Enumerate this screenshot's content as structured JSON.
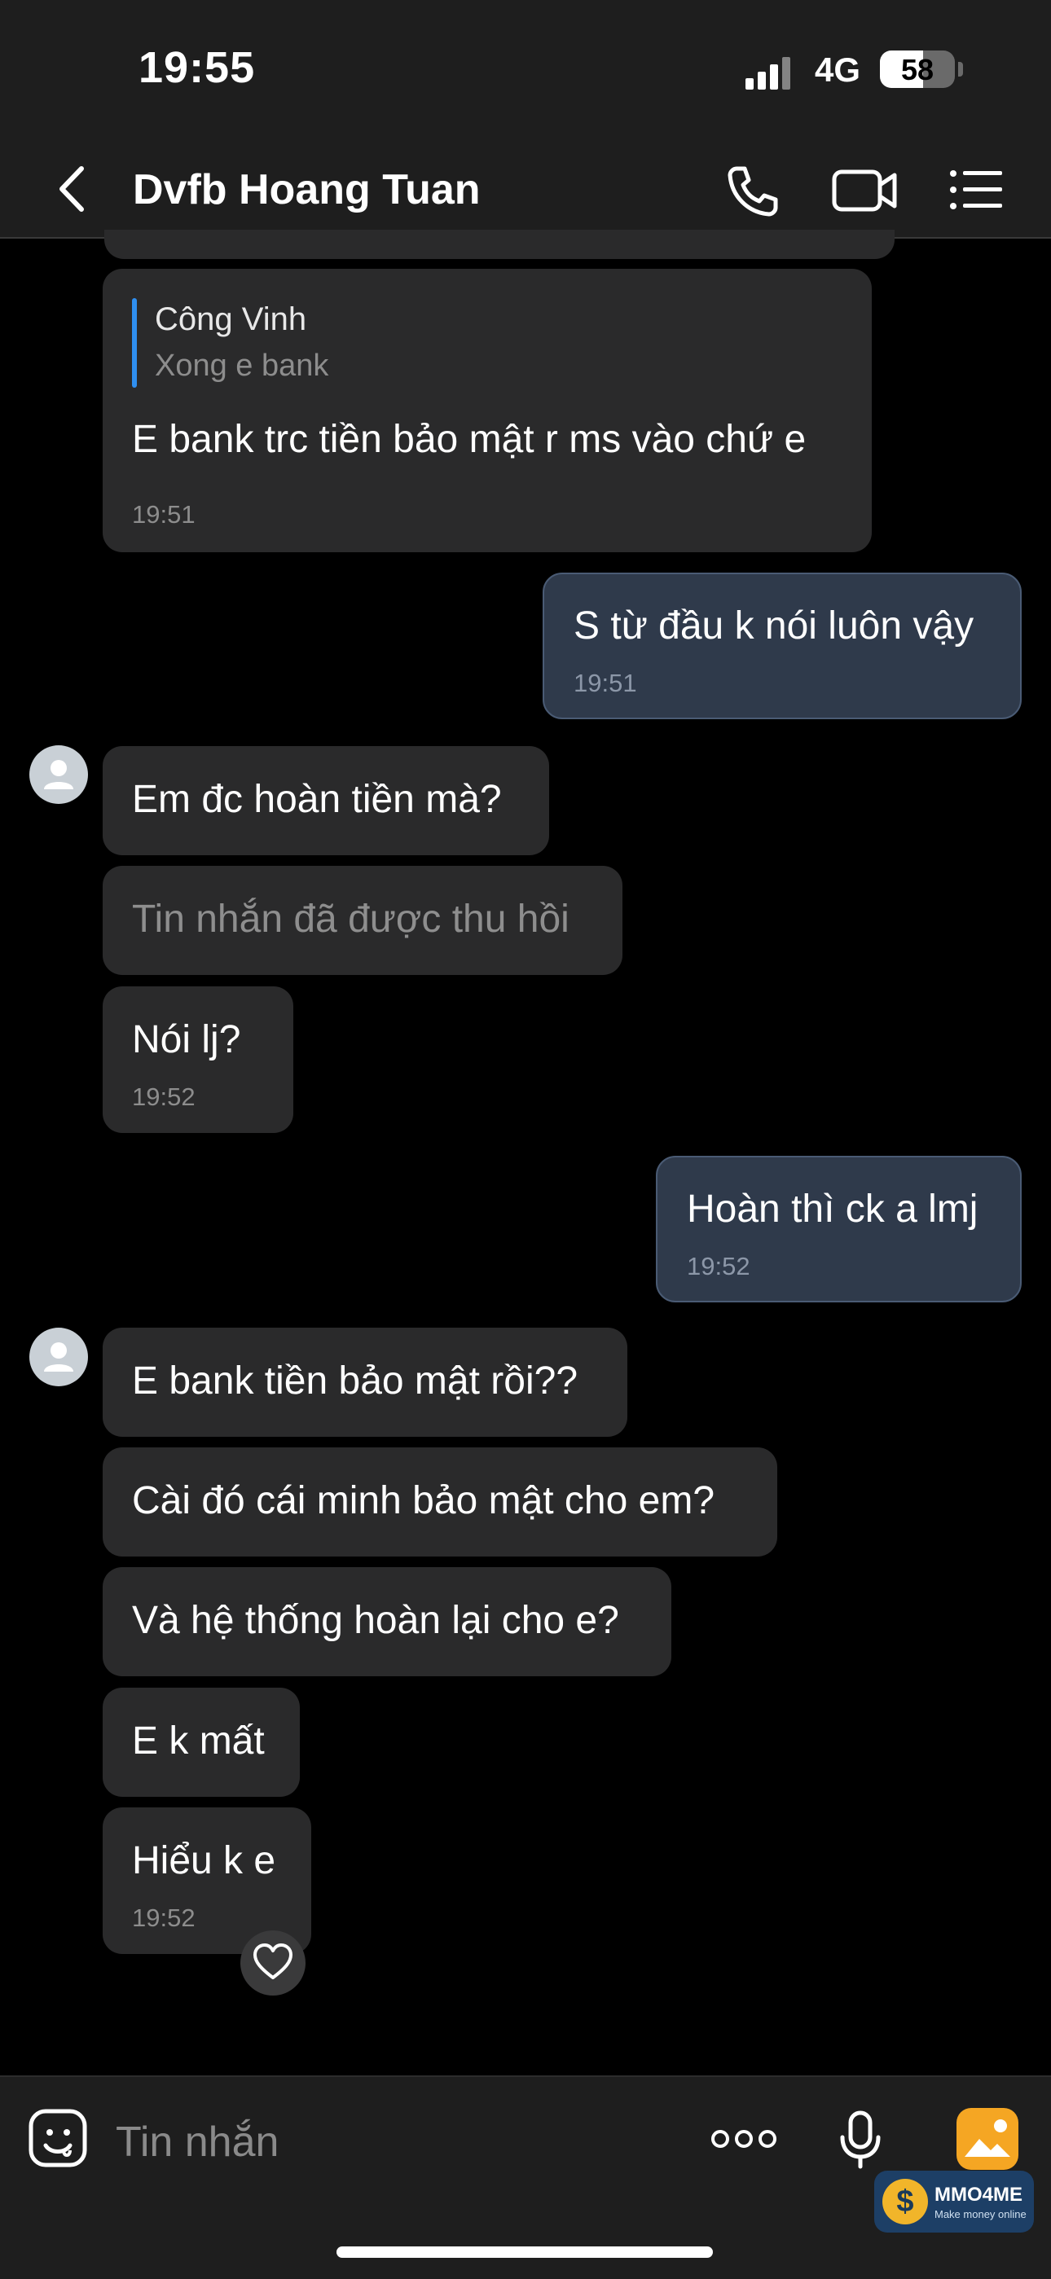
{
  "status_bar": {
    "time": "19:55",
    "network": "4G",
    "battery": "58",
    "battery_level": 0.58
  },
  "header": {
    "title": "Dvfb Hoang Tuan",
    "icons": [
      "back-icon",
      "phone-icon",
      "video-call-icon",
      "menu-list-icon"
    ]
  },
  "messages": [
    {
      "side": "in",
      "quote_name": "Công Vinh",
      "quote_text": "Xong e bank",
      "text": "E bank trc tiền bảo mật r ms vào chứ e",
      "time": "19:51"
    },
    {
      "side": "out",
      "text": "S từ đầu k nói luôn vậy",
      "time": "19:51"
    },
    {
      "side": "in",
      "text": "Em đc hoàn tiền mà?"
    },
    {
      "side": "in",
      "text": "Tin nhắn đã được thu hồi",
      "recalled": true
    },
    {
      "side": "in",
      "text": "Nói lj?",
      "time": "19:52"
    },
    {
      "side": "out",
      "text": "Hoàn thì ck a lmj",
      "time": "19:52"
    },
    {
      "side": "in",
      "text": "E bank tiền bảo mật rồi??"
    },
    {
      "side": "in",
      "text": "Cài đó cái minh bảo mật cho em?"
    },
    {
      "side": "in",
      "text": "Và hệ thống hoàn lại cho e?"
    },
    {
      "side": "in",
      "text": "E k mất"
    },
    {
      "side": "in",
      "text": "Hiểu k e",
      "time": "19:52"
    }
  ],
  "composer": {
    "placeholder": "Tin nhắn",
    "icons": [
      "emoji-icon",
      "more-icon",
      "microphone-icon",
      "image-icon"
    ]
  },
  "watermark": {
    "title": "MMO4ME",
    "subtitle": "Make money online"
  },
  "colors": {
    "background": "#000000",
    "bar": "#1e1e1e",
    "incoming_bubble": "#2a2a2b",
    "outgoing_bubble": "#2f3a4b",
    "accent": "#2f8ff0"
  }
}
